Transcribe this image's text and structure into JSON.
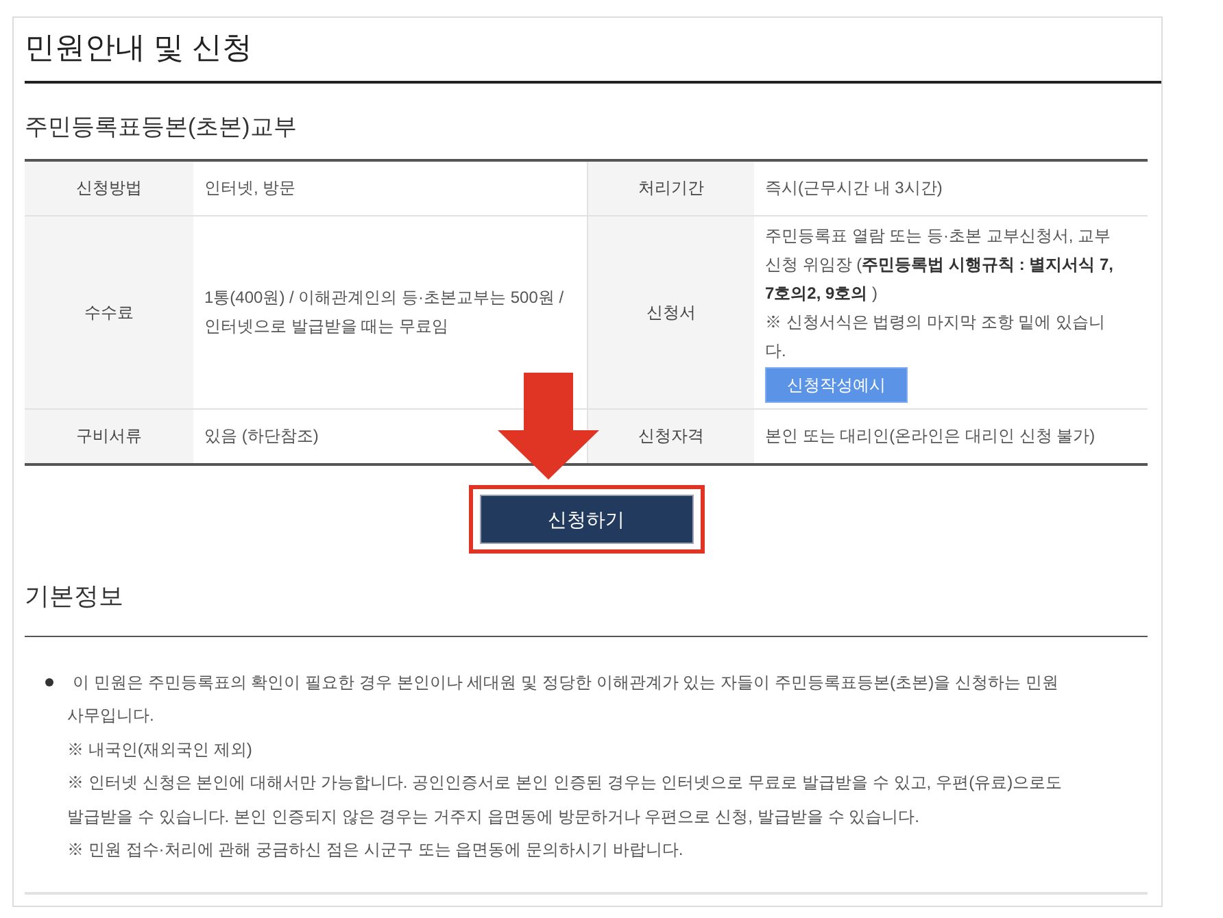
{
  "page_title": "민원안내 및 신청",
  "service": {
    "title": "주민등록표등본(초본)교부",
    "rows": [
      {
        "cells": [
          {
            "label": "신청방법",
            "value": "인터넷, 방문"
          },
          {
            "label": "처리기간",
            "value": "즉시(근무시간 내 3시간)"
          }
        ]
      },
      {
        "cells": [
          {
            "label": "수수료",
            "value": "1통(400원) / 이해관계인의 등·초본교부는 500원 / 인터넷으로 발급받을 때는 무료임"
          },
          {
            "label": "신청서",
            "value": "주민등록표 열람 또는 등·초본 교부신청서, 교부 신청 위임장 (**주민등록법 시행규칙 : 별지서식 7, 7호의2, 9호의** )",
            "note": "※ 신청서식은 법령의 마지막 조항 밑에 있습니다.",
            "button": "신청작성예시"
          }
        ]
      },
      {
        "cells": [
          {
            "label": "구비서류",
            "value": "있음 (하단참조)"
          },
          {
            "label": "신청자격",
            "value": "본인 또는 대리인(온라인은 대리인 신청 불가)"
          }
        ]
      }
    ]
  },
  "apply_button": {
    "label": "신청하기",
    "highlighted": true
  },
  "basic_info": {
    "title": "기본정보",
    "items": [
      {
        "text": "이 민원은 주민등록표의 확인이 필요한 경우 본인이나 세대원 및 정당한 이해관계가 있는 자들이 주민등록표등본(초본)을 신청하는 민원 사무입니다.",
        "notes": [
          "※ 내국인(재외국인 제외)",
          "※ 인터넷 신청은 본인에 대해서만 가능합니다. 공인인증서로 본인 인증된 경우는 인터넷으로 무료로 발급받을 수 있고, 우편(유료)으로도 발급받을 수 있습니다. 본인 인증되지 않은 경우는 거주지 읍면동에 방문하거나 우편으로 신청, 발급받을 수 있습니다.",
          "※ 민원 접수·처리에 관해 궁금하신 점은 시군구 또는 읍면동에 문의하시기 바랍니다."
        ]
      }
    ]
  }
}
